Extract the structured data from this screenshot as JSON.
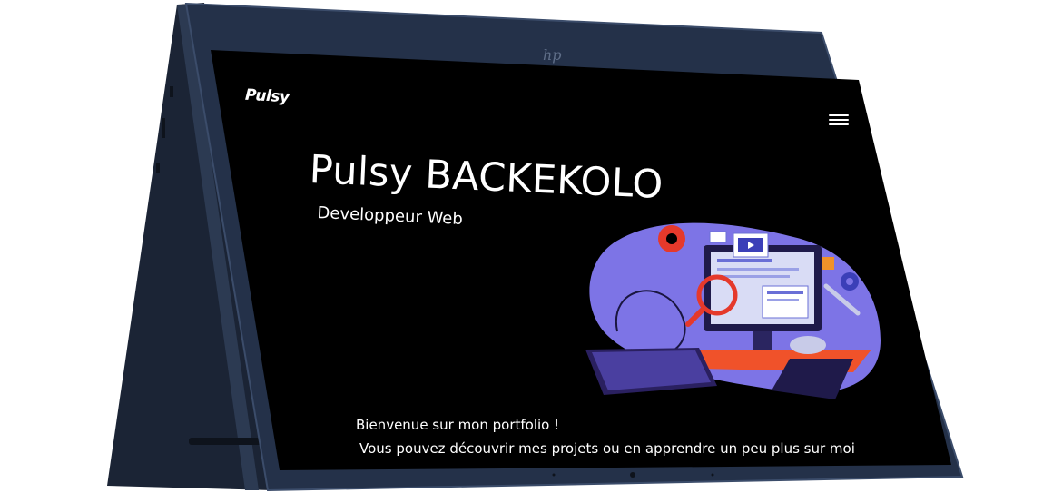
{
  "site": {
    "logo_text": "Pulsy",
    "menu_icon": "hamburger-menu-icon"
  },
  "hero": {
    "name": "Pulsy BACKEKOLO",
    "role": "Developpeur Web",
    "welcome_line1": "Bienvenue sur mon portfolio !",
    "welcome_line2": "Vous pouvez découvrir mes projets ou en apprendre un peu plus sur moi"
  },
  "colors": {
    "screen_bg": "#000000",
    "device_body": "#1f2a3d",
    "device_edge": "#33425c",
    "text": "#ffffff",
    "blob": "#7d74e6",
    "accent_orange": "#f0522a",
    "gear_red": "#e5392b"
  }
}
